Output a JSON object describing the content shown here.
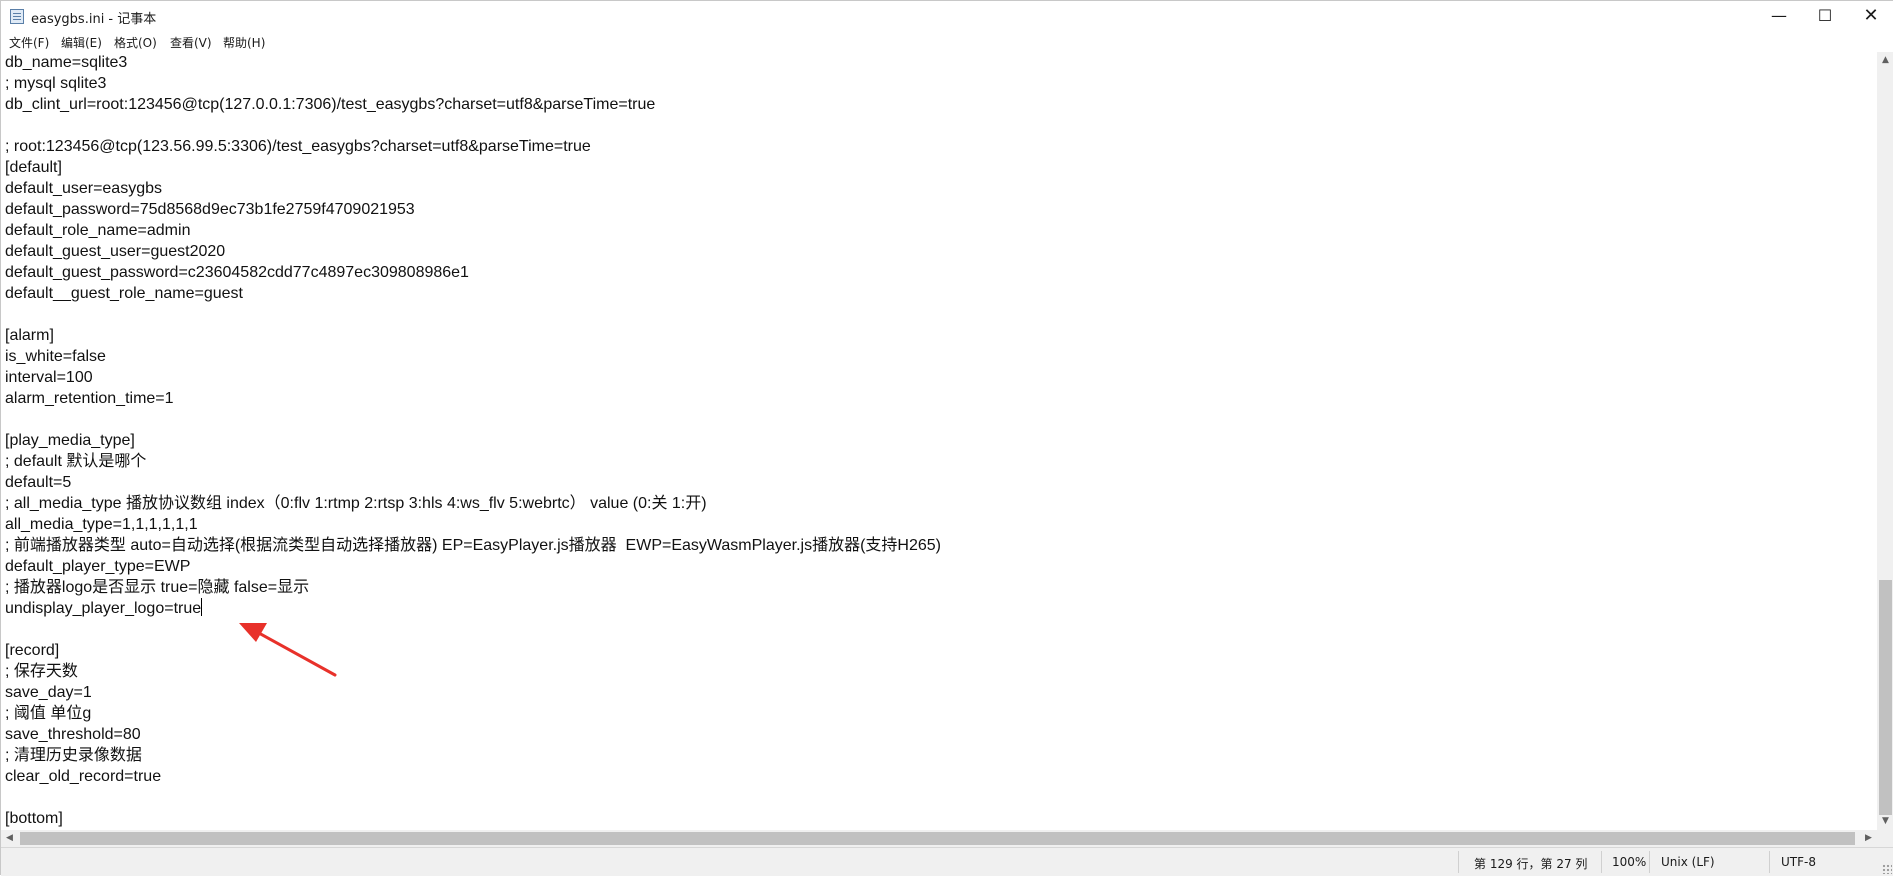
{
  "window": {
    "title": "easygbs.ini - 记事本",
    "minimize_glyph": "—",
    "maximize_glyph": "☐",
    "close_glyph": "✕"
  },
  "menu": {
    "items": [
      "文件(F)",
      "编辑(E)",
      "格式(O)",
      "查看(V)",
      "帮助(H)"
    ]
  },
  "editor": {
    "lines": [
      "db_name=sqlite3",
      "; mysql sqlite3",
      "db_clint_url=root:123456@tcp(127.0.0.1:7306)/test_easygbs?charset=utf8&parseTime=true",
      "",
      "; root:123456@tcp(123.56.99.5:3306)/test_easygbs?charset=utf8&parseTime=true",
      "[default]",
      "default_user=easygbs",
      "default_password=75d8568d9ec73b1fe2759f4709021953",
      "default_role_name=admin",
      "default_guest_user=guest2020",
      "default_guest_password=c23604582cdd77c4897ec309808986e1",
      "default__guest_role_name=guest",
      "",
      "[alarm]",
      "is_white=false",
      "interval=100",
      "alarm_retention_time=1",
      "",
      "[play_media_type]",
      "; default 默认是哪个",
      "default=5",
      "; all_media_type 播放协议数组 index（0:flv 1:rtmp 2:rtsp 3:hls 4:ws_flv 5:webrtc） value (0:关 1:开)",
      "all_media_type=1,1,1,1,1,1",
      "; 前端播放器类型 auto=自动选择(根据流类型自动选择播放器) EP=EasyPlayer.js播放器  EWP=EasyWasmPlayer.js播放器(支持H265)",
      "default_player_type=EWP",
      "; 播放器logo是否显示 true=隐藏 false=显示",
      "undisplay_player_logo=true",
      "",
      "[record]",
      "; 保存天数",
      "save_day=1",
      "; 阈值 单位g",
      "save_threshold=80",
      "; 清理历史录像数据",
      "clear_old_record=true",
      "",
      "[bottom]"
    ],
    "caret_line": 26
  },
  "scrollbars": {
    "up_glyph": "▲",
    "down_glyph": "▼",
    "left_glyph": "◀",
    "right_glyph": "▶"
  },
  "status": {
    "position": "第 129 行，第 27 列",
    "zoom": "100%",
    "line_ending": "Unix (LF)",
    "encoding": "UTF-8"
  },
  "colors": {
    "annotation_arrow": "#e8312a"
  }
}
